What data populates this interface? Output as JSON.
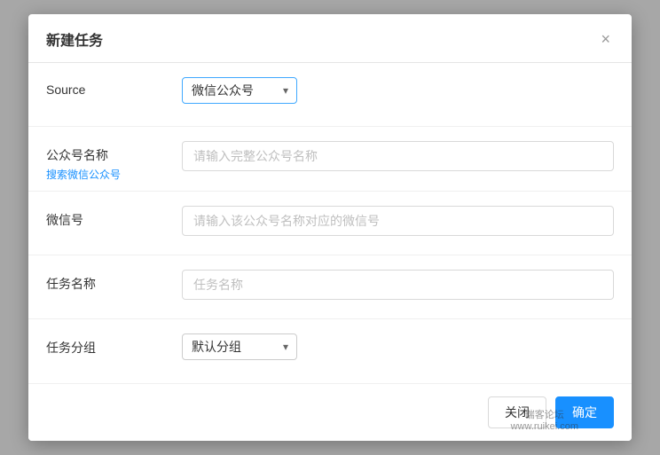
{
  "dialog": {
    "title": "新建任务",
    "close_label": "×"
  },
  "form": {
    "rows": [
      {
        "id": "source",
        "label": "Source",
        "label_sub": null,
        "type": "select",
        "select_options": [
          "微信公众号"
        ],
        "select_value": "微信公众号",
        "placeholder": null
      },
      {
        "id": "account_name",
        "label": "公众号名称",
        "label_sub": "搜索微信公众号",
        "type": "input",
        "placeholder": "请输入完整公众号名称",
        "select_options": null
      },
      {
        "id": "wechat_id",
        "label": "微信号",
        "label_sub": null,
        "type": "input",
        "placeholder": "请输入该公众号名称对应的微信号",
        "select_options": null
      },
      {
        "id": "task_name",
        "label": "任务名称",
        "label_sub": null,
        "type": "input",
        "placeholder": "任务名称",
        "select_options": null
      },
      {
        "id": "task_group",
        "label": "任务分组",
        "label_sub": null,
        "type": "select",
        "select_options": [
          "默认分组"
        ],
        "select_value": "默认分组",
        "placeholder": null
      }
    ]
  },
  "footer": {
    "cancel_label": "关闭",
    "confirm_label": "确定"
  },
  "watermark": {
    "line1": "瑞客论坛",
    "line2": "www.ruikei.com"
  }
}
